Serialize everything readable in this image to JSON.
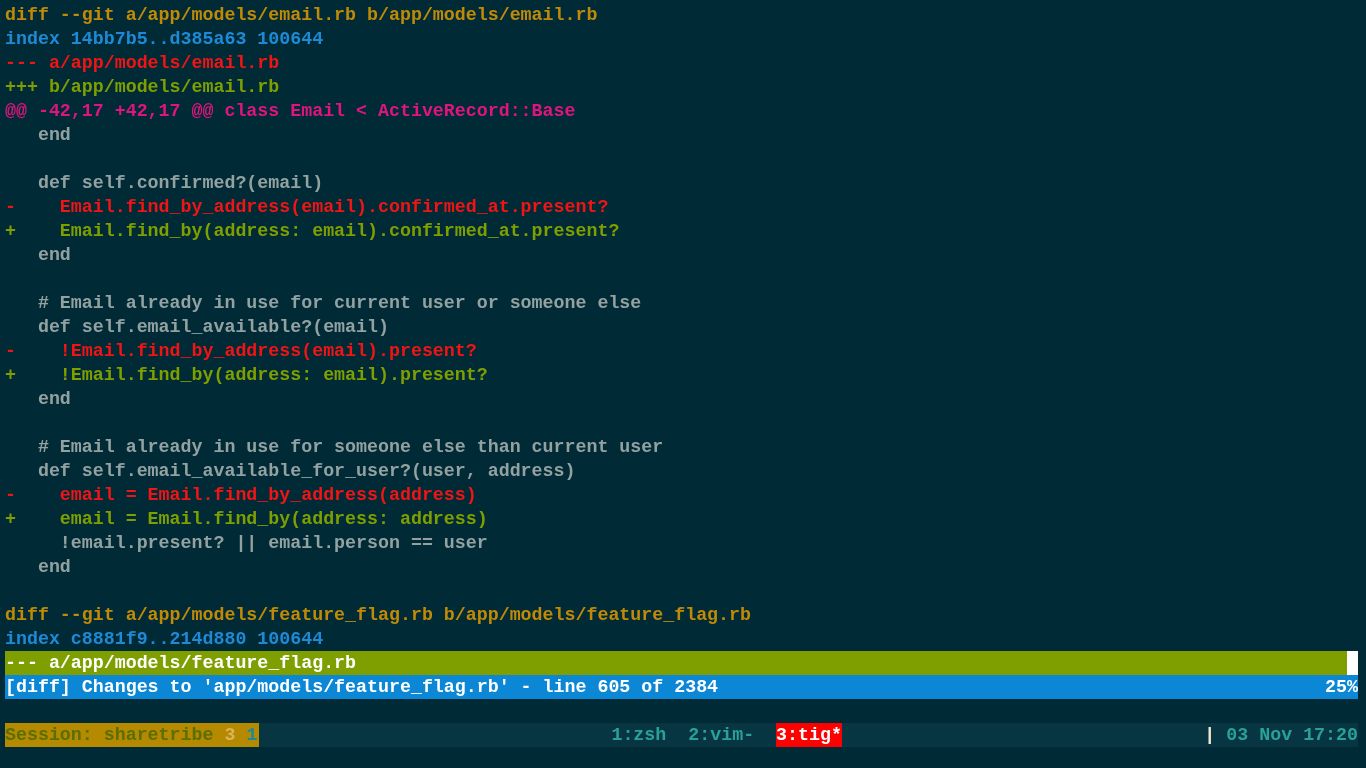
{
  "diff_lines": [
    {
      "kind": "header",
      "text": "diff --git a/app/models/email.rb b/app/models/email.rb",
      "selected": false
    },
    {
      "kind": "index",
      "text": "index 14bb7b5..d385a63 100644",
      "selected": false
    },
    {
      "kind": "old-file",
      "text": "--- a/app/models/email.rb",
      "selected": false
    },
    {
      "kind": "new-file",
      "text": "+++ b/app/models/email.rb",
      "selected": false
    },
    {
      "kind": "hunk",
      "text": "@@ -42,17 +42,17 @@ class Email < ActiveRecord::Base",
      "selected": false
    },
    {
      "kind": "context",
      "text": "   end",
      "selected": false
    },
    {
      "kind": "blank",
      "selected": false
    },
    {
      "kind": "context",
      "text": "   def self.confirmed?(email)",
      "selected": false
    },
    {
      "kind": "removed",
      "text": "-    Email.find_by_address(email).confirmed_at.present?",
      "selected": false
    },
    {
      "kind": "added",
      "text": "+    Email.find_by(address: email).confirmed_at.present?",
      "selected": false
    },
    {
      "kind": "context",
      "text": "   end",
      "selected": false
    },
    {
      "kind": "blank",
      "selected": false
    },
    {
      "kind": "context",
      "text": "   # Email already in use for current user or someone else",
      "selected": false
    },
    {
      "kind": "context",
      "text": "   def self.email_available?(email)",
      "selected": false
    },
    {
      "kind": "removed",
      "text": "-    !Email.find_by_address(email).present?",
      "selected": false
    },
    {
      "kind": "added",
      "text": "+    !Email.find_by(address: email).present?",
      "selected": false
    },
    {
      "kind": "context",
      "text": "   end",
      "selected": false
    },
    {
      "kind": "blank",
      "selected": false
    },
    {
      "kind": "context",
      "text": "   # Email already in use for someone else than current user",
      "selected": false
    },
    {
      "kind": "context",
      "text": "   def self.email_available_for_user?(user, address)",
      "selected": false
    },
    {
      "kind": "removed",
      "text": "-    email = Email.find_by_address(address)",
      "selected": false
    },
    {
      "kind": "added",
      "text": "+    email = Email.find_by(address: address)",
      "selected": false
    },
    {
      "kind": "context",
      "text": "     !email.present? || email.person == user",
      "selected": false
    },
    {
      "kind": "context",
      "text": "   end",
      "selected": false
    },
    {
      "kind": "blank",
      "selected": false
    },
    {
      "kind": "header",
      "text": "diff --git a/app/models/feature_flag.rb b/app/models/feature_flag.rb",
      "selected": false
    },
    {
      "kind": "index",
      "text": "index c8881f9..214d880 100644",
      "selected": false
    },
    {
      "kind": "old-file",
      "text": "--- a/app/models/feature_flag.rb",
      "selected": true
    }
  ],
  "status_bar": {
    "view": "[diff] Changes to 'app/models/feature_flag.rb' - line 605 of 2384",
    "percent": "25%"
  },
  "tmux_bar": {
    "session": {
      "label": "Session: sharetribe",
      "count": "3",
      "pane": "1"
    },
    "windows": [
      {
        "label": "1:zsh",
        "selected": false
      },
      {
        "label": "2:vim-",
        "selected": false
      },
      {
        "label": "3:tig*",
        "selected": true
      }
    ],
    "separator": "|",
    "clock": "03 Nov 17:20"
  }
}
